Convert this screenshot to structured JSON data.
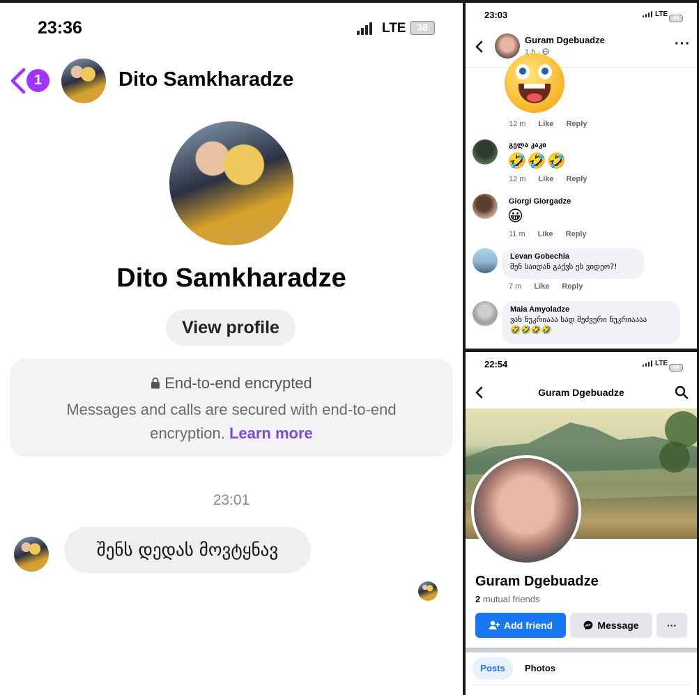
{
  "left": {
    "status": {
      "time": "23:36",
      "network": "LTE",
      "battery": "38"
    },
    "header": {
      "back_count": "1",
      "name": "Dito Samkharadze"
    },
    "profile": {
      "name": "Dito Samkharadze",
      "view_profile": "View profile"
    },
    "encryption": {
      "title": "End-to-end encrypted",
      "line1": "Messages and calls are secured with end-to-end",
      "line2": "encryption.",
      "learn_more": "Learn more"
    },
    "timestamp": "23:01",
    "message": "შენს დედას მოვტყნავ"
  },
  "topright": {
    "status": {
      "time": "23:03",
      "network": "LTE",
      "battery": "46"
    },
    "header": {
      "name": "Guram Dgebuadze",
      "meta": "1 h ·"
    },
    "comments": [
      {
        "time": "12 m",
        "like": "Like",
        "reply": "Reply"
      },
      {
        "name": "გელა კაკი",
        "emoji": "🤣🤣🤣",
        "time": "12 m",
        "like": "Like",
        "reply": "Reply"
      },
      {
        "name": "Giorgi Giorgadze",
        "emoji": "😀",
        "time": "11 m",
        "like": "Like",
        "reply": "Reply"
      },
      {
        "name": "Levan Gobechia",
        "text": "შენ საიდან გაქვს ეს ვიდეო?!",
        "time": "7 m",
        "like": "Like",
        "reply": "Reply"
      },
      {
        "name": "Maia Amyoladze",
        "text": "ვახ ნუკრიააა სად შეძვერი ნუკრიაააა",
        "emoji": "🤣🤣🤣🤣"
      }
    ]
  },
  "botright": {
    "status": {
      "time": "22:54",
      "network": "LTE",
      "battery": "49"
    },
    "header": {
      "title": "Guram Dgebuadze"
    },
    "profile": {
      "name": "Guram Dgebuadze",
      "mutual_count": "2",
      "mutual_label": "mutual friends",
      "add_friend": "Add friend",
      "message": "Message",
      "more": "···"
    },
    "tabs": [
      "Posts",
      "Photos"
    ]
  },
  "colors": {
    "fb_blue": "#1877f2",
    "messenger_purple": "#a033ff",
    "link_purple": "#7b4ad9"
  }
}
